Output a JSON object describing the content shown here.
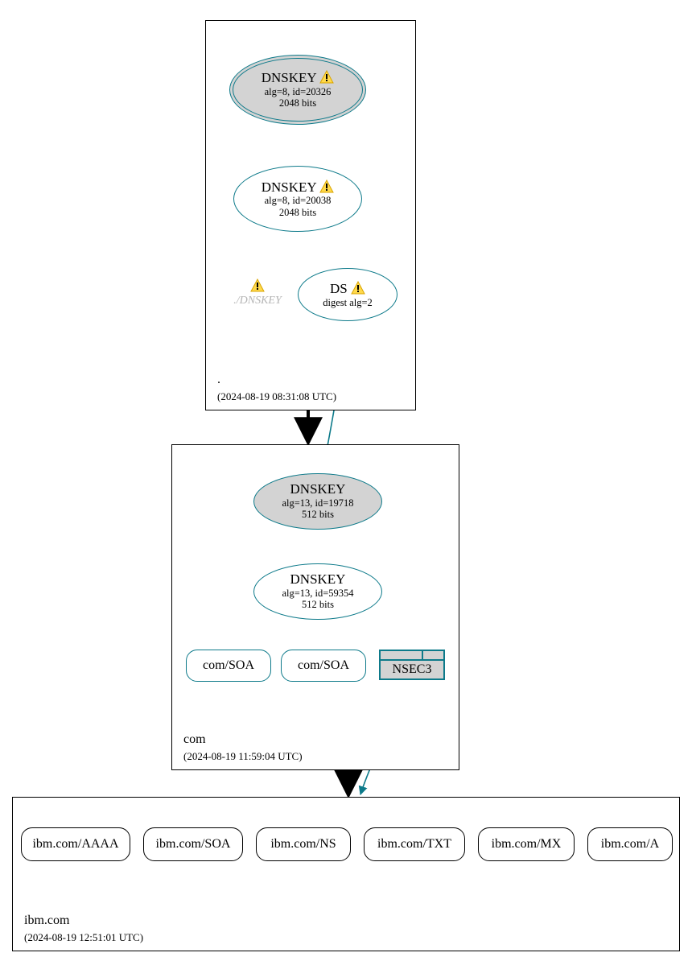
{
  "zones": {
    "root": {
      "label": ".",
      "timestamp": "(2024-08-19 08:31:08 UTC)",
      "dnskey_ksk": {
        "title": "DNSKEY",
        "alg": "alg=8, id=20326",
        "bits": "2048 bits",
        "warn": true
      },
      "dnskey_zsk": {
        "title": "DNSKEY",
        "alg": "alg=8, id=20038",
        "bits": "2048 bits",
        "warn": true
      },
      "ds": {
        "title": "DS",
        "sub": "digest alg=2",
        "warn": true
      },
      "ghost": {
        "label": "./DNSKEY",
        "warn": true
      }
    },
    "com": {
      "label": "com",
      "timestamp": "(2024-08-19 11:59:04 UTC)",
      "dnskey_ksk": {
        "title": "DNSKEY",
        "alg": "alg=13, id=19718",
        "bits": "512 bits"
      },
      "dnskey_zsk": {
        "title": "DNSKEY",
        "alg": "alg=13, id=59354",
        "bits": "512 bits"
      },
      "soa1": {
        "label": "com/SOA"
      },
      "soa2": {
        "label": "com/SOA"
      },
      "nsec3": {
        "label": "NSEC3"
      }
    },
    "ibm": {
      "label": "ibm.com",
      "timestamp": "(2024-08-19 12:51:01 UTC)",
      "rr": [
        "ibm.com/AAAA",
        "ibm.com/SOA",
        "ibm.com/NS",
        "ibm.com/TXT",
        "ibm.com/MX",
        "ibm.com/A"
      ]
    }
  }
}
